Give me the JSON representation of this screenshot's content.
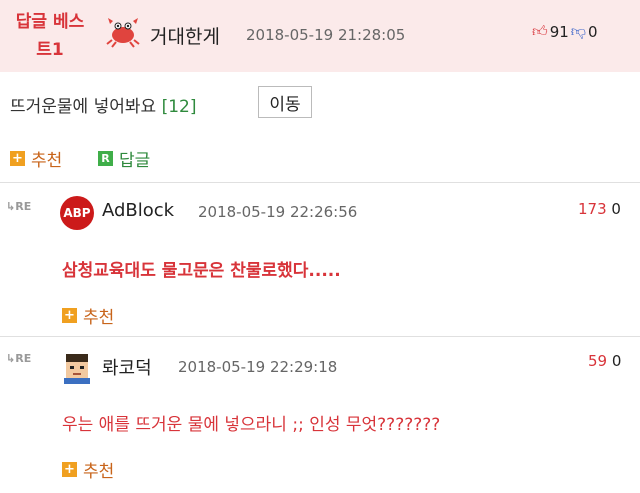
{
  "best": {
    "label": "답글 베스트1",
    "nickname": "거대한게",
    "timestamp": "2018-05-19 21:28:05",
    "upvotes": "91",
    "downvotes": "0"
  },
  "reply_header": {
    "title": "뜨거운물에 넣어봐요",
    "count": "[12]",
    "move_label": "이동"
  },
  "actions": {
    "recommend_label": "추천",
    "reply_label": "답글"
  },
  "comments": [
    {
      "re": "RE",
      "avatar_text": "ABP",
      "nickname": "AdBlock",
      "timestamp": "2018-05-19 22:26:56",
      "upvotes": "173",
      "downvotes": "0",
      "text": "삼청교육대도 물고문은 찬물로했다.....",
      "recommend_label": "추천"
    },
    {
      "re": "RE",
      "nickname": "롸코덕",
      "timestamp": "2018-05-19 22:29:18",
      "upvotes": "59",
      "downvotes": "0",
      "text": "우는 애를 뜨거운 물에 넣으라니 ;; 인성 무엇???????",
      "recommend_label": "추천"
    }
  ],
  "colors": {
    "accent_red": "#d8343a",
    "best_bg": "#fbeaea",
    "reply_green": "#2f8a3d",
    "recommend_orange": "#f0a020"
  }
}
